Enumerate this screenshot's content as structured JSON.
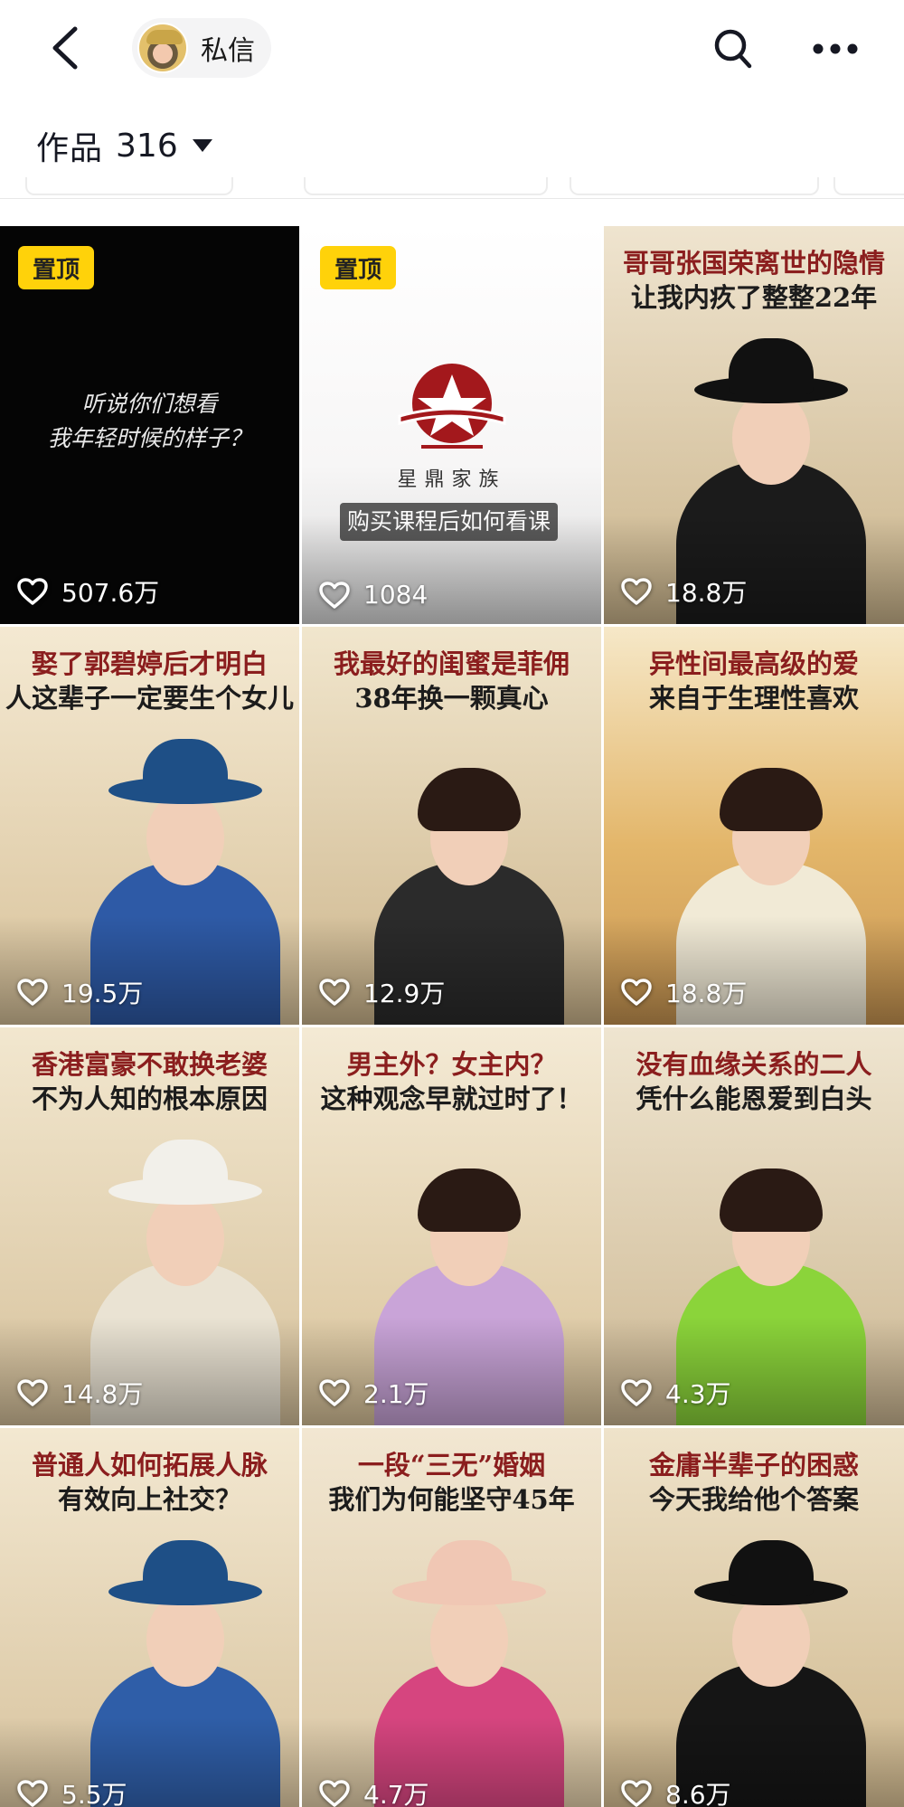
{
  "header": {
    "back_icon": "chevron-left-icon",
    "dm_label": "私信",
    "search_icon": "search-icon",
    "more_icon": "more-dots-icon"
  },
  "works": {
    "title": "作品",
    "count": "316"
  },
  "videos": [
    {
      "pinned": true,
      "pin_label": "置顶",
      "likes": "507.6万",
      "cover_lines": [
        "听说你们想看",
        "我年轻时候的样子？"
      ],
      "theme": "dark"
    },
    {
      "pinned": true,
      "pin_label": "置顶",
      "likes": "1084",
      "logo_text": "星鼎家族",
      "caption": "购买课程后如何看课",
      "theme": "logo"
    },
    {
      "pinned": false,
      "likes": "18.8万",
      "cover_lines": [
        "哥哥张国荣离世的隐情",
        "让我内疚了整整22年"
      ],
      "theme": "photo"
    },
    {
      "pinned": false,
      "likes": "19.5万",
      "cover_lines": [
        "娶了郭碧婷后才明白",
        "人这辈子一定要生个女儿"
      ],
      "theme": "photo"
    },
    {
      "pinned": false,
      "likes": "12.9万",
      "cover_lines": [
        "我最好的闺蜜是菲佣",
        "38年换一颗真心"
      ],
      "theme": "photo"
    },
    {
      "pinned": false,
      "likes": "18.8万",
      "cover_lines": [
        "异性间最高级的爱",
        "来自于生理性喜欢"
      ],
      "theme": "photo"
    },
    {
      "pinned": false,
      "likes": "14.8万",
      "cover_lines": [
        "香港富豪不敢换老婆",
        "不为人知的根本原因"
      ],
      "theme": "photo"
    },
    {
      "pinned": false,
      "likes": "2.1万",
      "cover_lines": [
        "男主外？女主内？",
        "这种观念早就过时了！"
      ],
      "theme": "photo"
    },
    {
      "pinned": false,
      "likes": "4.3万",
      "cover_lines": [
        "没有血缘关系的二人",
        "凭什么能恩爱到白头"
      ],
      "theme": "photo"
    },
    {
      "pinned": false,
      "likes": "5.5万",
      "cover_lines": [
        "普通人如何拓展人脉",
        "有效向上社交？"
      ],
      "theme": "photo"
    },
    {
      "pinned": false,
      "likes": "4.7万",
      "cover_lines": [
        "一段“三无”婚姻",
        "我们为何能坚守45年"
      ],
      "theme": "photo"
    },
    {
      "pinned": false,
      "likes": "8.6万",
      "cover_lines": [
        "金庸半辈子的困惑",
        "今天我给他个答案"
      ],
      "theme": "photo"
    }
  ],
  "colors": {
    "pin_badge": "#ffd20a",
    "title_red": "#8b1e1e",
    "logo_red": "#a3181c"
  }
}
